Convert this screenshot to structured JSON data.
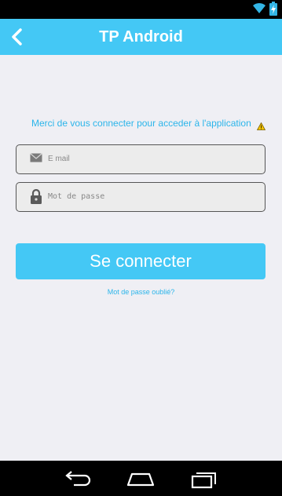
{
  "app_bar": {
    "title": "TP Android"
  },
  "login": {
    "info_message": "Merci de vous connecter pour acceder à l'application",
    "email_placeholder": "E mail",
    "password_placeholder": "Mot de passe",
    "submit_label": "Se connecter",
    "forgot_password_link": "Mot de passe oublié?"
  },
  "icons": {
    "back": "chevron-left-icon",
    "warning": "warning-icon",
    "email": "envelope-icon",
    "password": "lock-icon",
    "wifi": "wifi-icon",
    "battery": "battery-charging-icon",
    "nav_back": "nav-back-icon",
    "nav_home": "nav-home-icon",
    "nav_recent": "nav-recent-apps-icon"
  },
  "colors": {
    "accent": "#44c8f5",
    "link_text": "#2bb5ea",
    "background": "#efeff4",
    "system_bar": "#000000",
    "warning": "#f5c400"
  }
}
